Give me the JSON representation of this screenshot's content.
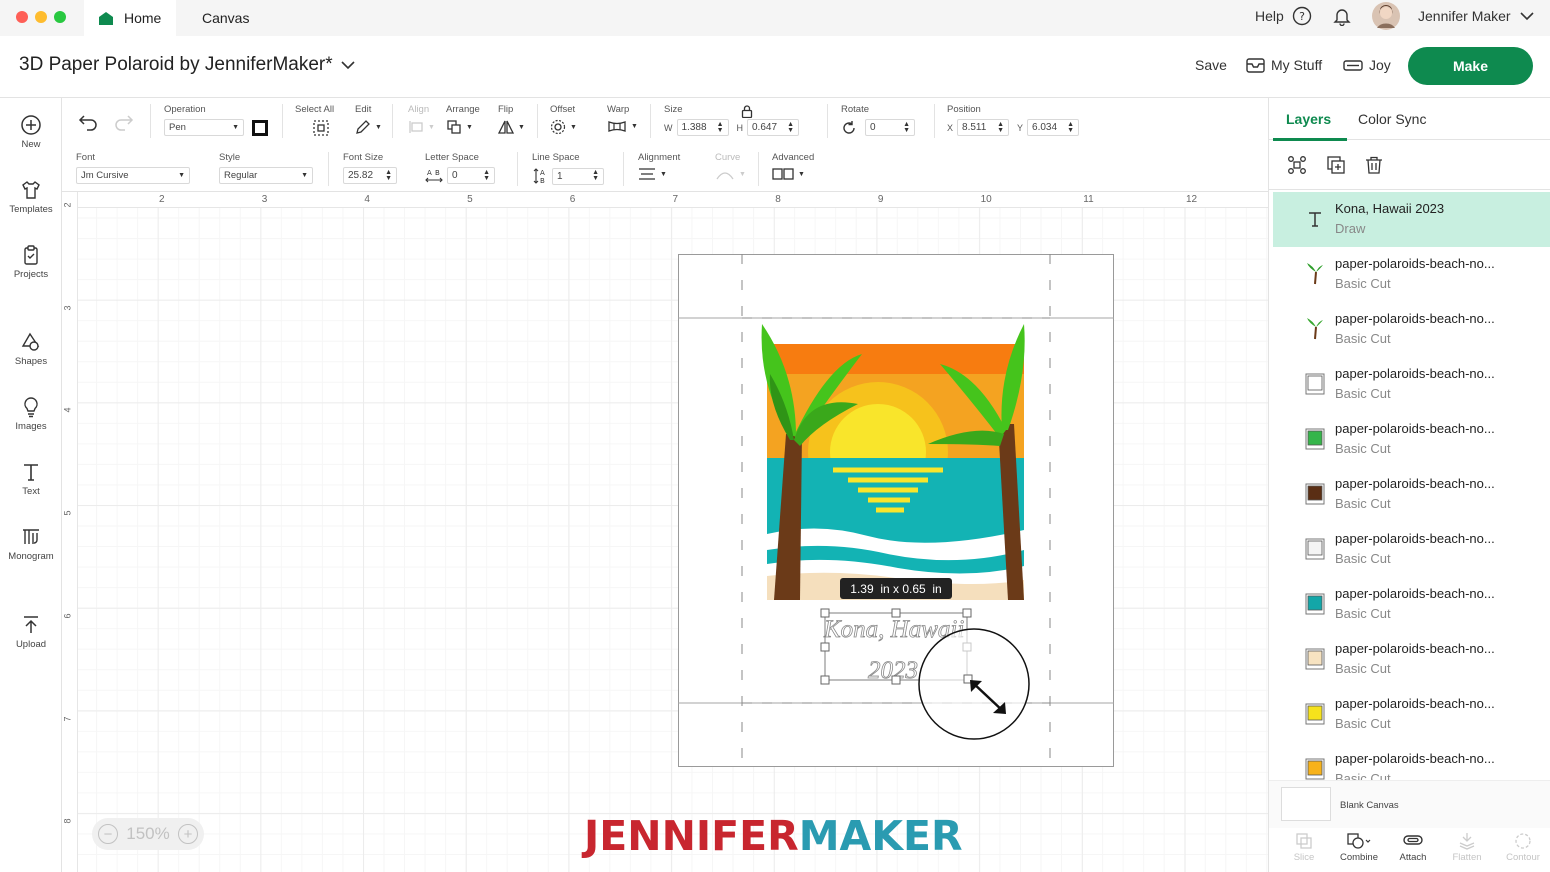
{
  "tabs": {
    "home": "Home",
    "canvas": "Canvas"
  },
  "topbar": {
    "help": "Help",
    "user": "Jennifer Maker"
  },
  "titlebar": {
    "title": "3D Paper Polaroid by JenniferMaker*",
    "save": "Save",
    "my_stuff": "My Stuff",
    "machine": "Joy",
    "make": "Make"
  },
  "sidebar": [
    "New",
    "Templates",
    "Projects",
    "Shapes",
    "Images",
    "Text",
    "Monogram",
    "Upload"
  ],
  "toolbar1": {
    "operation_label": "Operation",
    "operation_value": "Pen",
    "select_all": "Select All",
    "edit": "Edit",
    "align": "Align",
    "arrange": "Arrange",
    "flip": "Flip",
    "offset": "Offset",
    "warp": "Warp",
    "size": "Size",
    "w_label": "W",
    "w": "1.388",
    "h_label": "H",
    "h": "0.647",
    "rotate": "Rotate",
    "rotate_value": "0",
    "position": "Position",
    "x_label": "X",
    "x": "8.511",
    "y_label": "Y",
    "y": "6.034"
  },
  "toolbar2": {
    "font_label": "Font",
    "font_value": "Jm Cursive",
    "style_label": "Style",
    "style_value": "Regular",
    "font_size_label": "Font Size",
    "font_size": "25.82",
    "letter_space_label": "Letter Space",
    "letter_space": "0",
    "line_space_label": "Line Space",
    "line_space": "1",
    "alignment_label": "Alignment",
    "curve_label": "Curve",
    "advanced_label": "Advanced"
  },
  "ruler": {
    "top": [
      "2",
      "3",
      "4",
      "5",
      "6",
      "7",
      "8",
      "9",
      "10",
      "11",
      "12"
    ],
    "left": [
      "2",
      "3",
      "4",
      "5",
      "6",
      "7",
      "8"
    ]
  },
  "canvas": {
    "size_tooltip": "1.39  in x 0.65  in",
    "text_line1": "Kona, Hawaii",
    "text_line2": "2023",
    "zoom": "150%",
    "brand_a": "JENNIFER",
    "brand_b": "MAKER"
  },
  "rpanel": {
    "tab_layers": "Layers",
    "tab_color_sync": "Color Sync",
    "layers": [
      {
        "name": "Kona, Hawaii 2023",
        "op": "Draw",
        "icon": "text-icon",
        "color": ""
      },
      {
        "name": "paper-polaroids-beach-no...",
        "op": "Basic Cut",
        "icon": "palm-icon",
        "color": "#2e9e2a"
      },
      {
        "name": "paper-polaroids-beach-no...",
        "op": "Basic Cut",
        "icon": "palm-icon",
        "color": "#3aa832"
      },
      {
        "name": "paper-polaroids-beach-no...",
        "op": "Basic Cut",
        "icon": "frame-icon",
        "color": "#ffffff"
      },
      {
        "name": "paper-polaroids-beach-no...",
        "op": "Basic Cut",
        "icon": "frame-icon",
        "color": "#35b54a"
      },
      {
        "name": "paper-polaroids-beach-no...",
        "op": "Basic Cut",
        "icon": "frame-icon",
        "color": "#5a2e14"
      },
      {
        "name": "paper-polaroids-beach-no...",
        "op": "Basic Cut",
        "icon": "frame-icon",
        "color": "#f4f4f4"
      },
      {
        "name": "paper-polaroids-beach-no...",
        "op": "Basic Cut",
        "icon": "frame-icon",
        "color": "#13a6a8"
      },
      {
        "name": "paper-polaroids-beach-no...",
        "op": "Basic Cut",
        "icon": "frame-icon",
        "color": "#f7e3c1"
      },
      {
        "name": "paper-polaroids-beach-no...",
        "op": "Basic Cut",
        "icon": "frame-icon",
        "color": "#f6e21c"
      },
      {
        "name": "paper-polaroids-beach-no...",
        "op": "Basic Cut",
        "icon": "frame-icon",
        "color": "#f7b21a"
      }
    ],
    "blank_canvas": "Blank Canvas",
    "bottom": [
      "Slice",
      "Combine",
      "Attach",
      "Flatten",
      "Contour"
    ]
  },
  "colors": {
    "accent": "#0e8a4f",
    "selected_layer": "#c8efe0"
  }
}
